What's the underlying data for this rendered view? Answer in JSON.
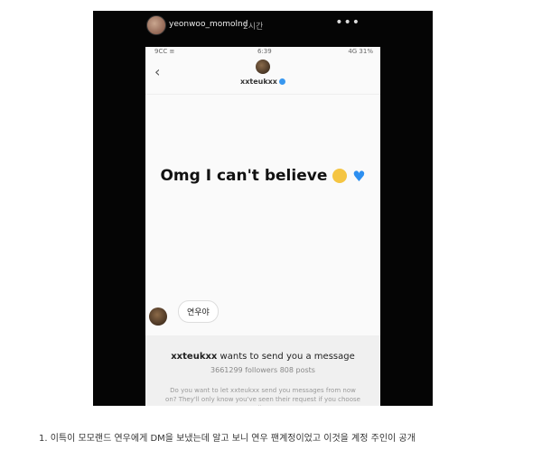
{
  "story": {
    "username": "yeonwoo_momolnd",
    "time": "2시간",
    "more": "•••"
  },
  "phone": {
    "status_left": "9CC ≡",
    "status_time": "6:39",
    "status_right": "4G 31%",
    "back_icon": "chevron-left-icon",
    "dm_username": "xxteukxx",
    "message": "Omg I can't believe",
    "bubble_text": "연우야",
    "request_title_user": "xxteukxx",
    "request_title_rest": " wants to send you a message",
    "request_stats": "3661299 followers 808 posts",
    "request_desc": "Do you want to let xxteukxx send you messages from now on? They'll only know you've seen their request if you choose allow."
  },
  "caption": "1. 이특이 모모랜드 연우에게 DM을 보냈는데 알고 보니 연우 팬계정이었고 이것을 계정 주인이 공개"
}
